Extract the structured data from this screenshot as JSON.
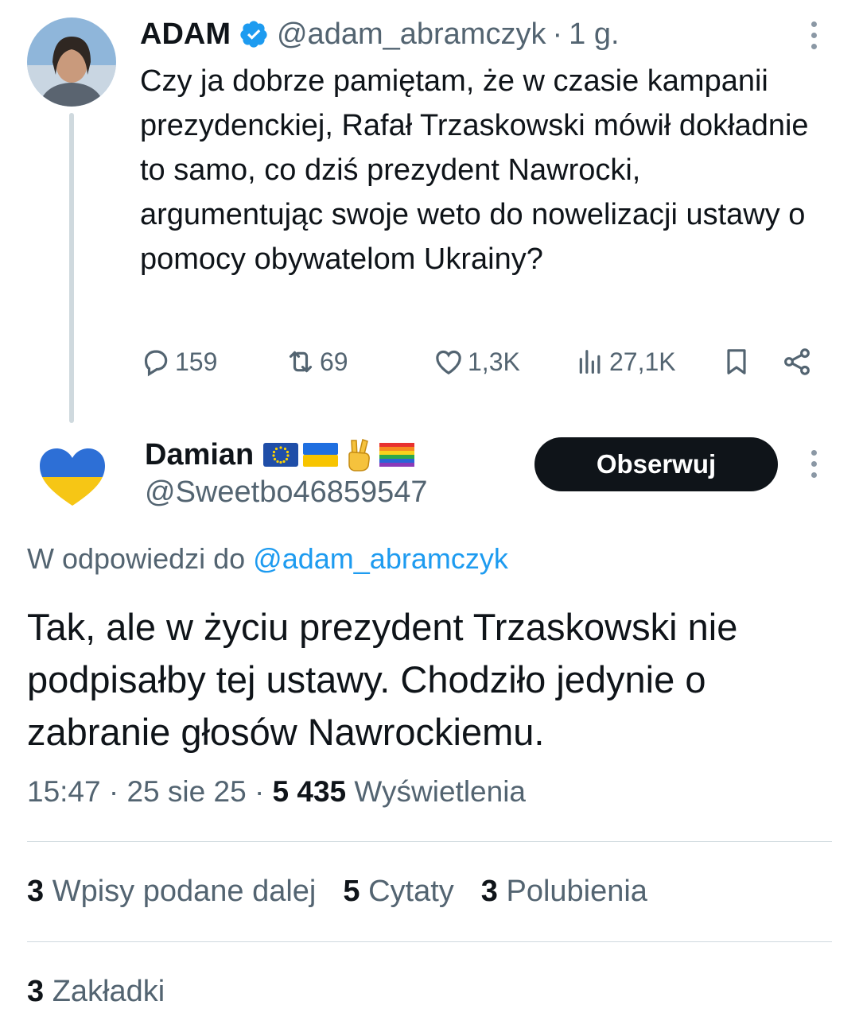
{
  "original_tweet": {
    "name": "ADAM",
    "handle": "@adam_abramczyk",
    "separator": "·",
    "time": "1 g.",
    "text": "Czy ja dobrze pamiętam, że w czasie kampanii prezydenckiej, Rafał Trzaskowski mówił dokładnie to samo, co dziś prezydent Nawrocki, argumentując swoje weto do nowelizacji ustawy o pomocy obywatelom Ukrainy?",
    "replies": "159",
    "reposts": "69",
    "likes": "1,3K",
    "views": "27,1K"
  },
  "reply": {
    "name": "Damian",
    "flags": [
      "eu-flag",
      "ukraine-flag",
      "victory-hand",
      "rainbow-flag"
    ],
    "handle": "@Sweetbo46859547",
    "follow_label": "Obserwuj",
    "reply_to_prefix": "W odpowiedzi do",
    "reply_to_handle": "@adam_abramczyk",
    "text": "Tak, ale w życiu prezydent Trzaskowski nie podpisałby tej ustawy. Chodziło jedynie o zabranie głosów Nawrockiemu.",
    "time": "15:47",
    "date": "25 sie 25",
    "views_count": "5 435",
    "views_label": "Wyświetlenia",
    "separator": "·",
    "stats": {
      "reposts_count": "3",
      "reposts_label": "Wpisy podane dalej",
      "quotes_count": "5",
      "quotes_label": "Cytaty",
      "likes_count": "3",
      "likes_label": "Polubienia",
      "bookmarks_count": "3",
      "bookmarks_label": "Zakładki"
    }
  },
  "colors": {
    "text": "#0f1419",
    "secondary": "#536471",
    "accent": "#1d9bf0",
    "button_bg": "#0f1419"
  }
}
